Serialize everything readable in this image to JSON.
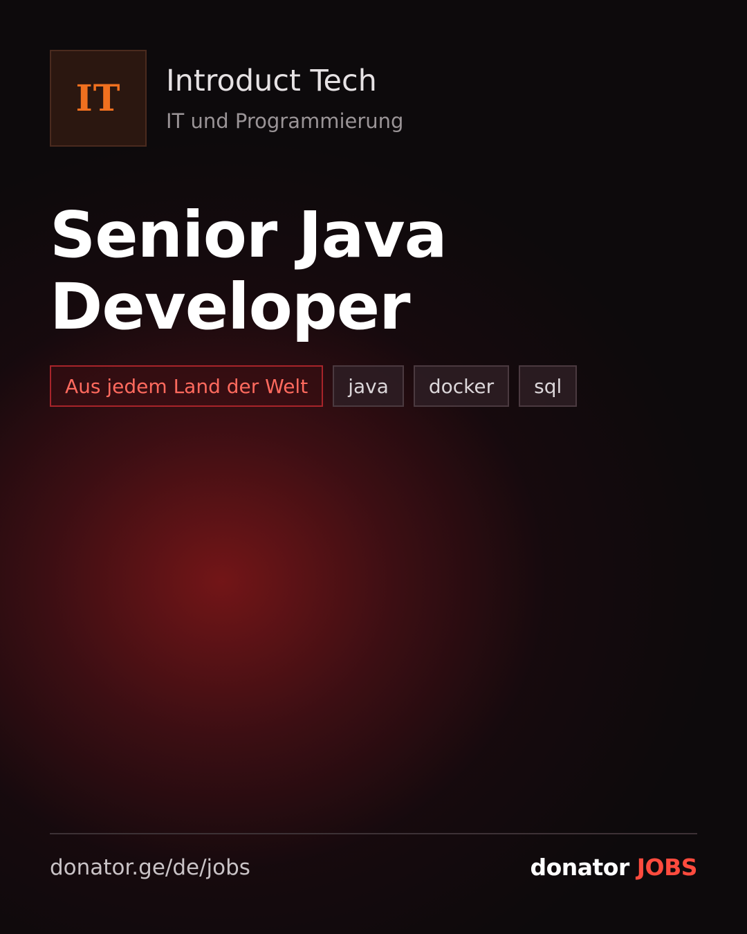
{
  "company": {
    "logo_text": "IT",
    "name": "Introduct Tech",
    "category": "IT und Programmierung"
  },
  "job": {
    "title_line1": "Senior Java",
    "title_line2": "Developer"
  },
  "tags": {
    "location": "Aus jedem Land der Welt",
    "skills": [
      "java",
      "docker",
      "sql"
    ]
  },
  "footer": {
    "url": "donator.ge/de/jobs",
    "brand_main": "donator",
    "brand_accent": "JOBS"
  },
  "colors": {
    "accent_orange": "#f0701f",
    "accent_red": "#ff4b3e",
    "background": "#0d0a0c"
  }
}
